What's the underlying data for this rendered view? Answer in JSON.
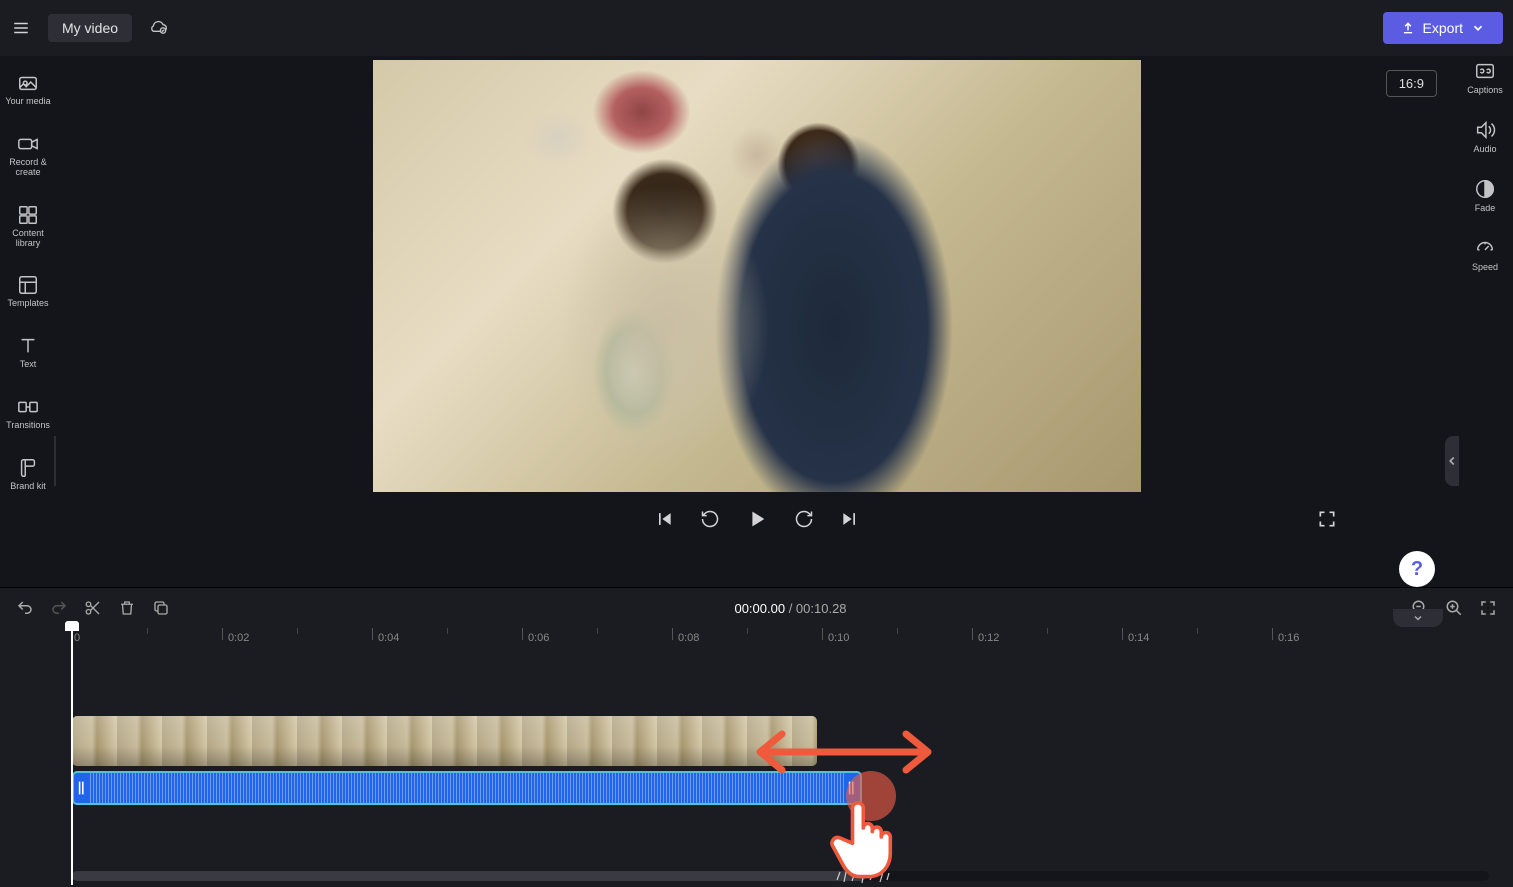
{
  "topbar": {
    "title": "My video",
    "export_label": "Export"
  },
  "aspect_ratio": "16:9",
  "left_sidebar": {
    "items": [
      {
        "label": "Your media"
      },
      {
        "label": "Record & create"
      },
      {
        "label": "Content library"
      },
      {
        "label": "Templates"
      },
      {
        "label": "Text"
      },
      {
        "label": "Transitions"
      },
      {
        "label": "Brand kit"
      }
    ]
  },
  "right_sidebar": {
    "items": [
      {
        "label": "Captions"
      },
      {
        "label": "Audio"
      },
      {
        "label": "Fade"
      },
      {
        "label": "Speed"
      }
    ]
  },
  "help_label": "?",
  "timecode": {
    "current": "00:00.00",
    "separator": " / ",
    "total": "00:10.28"
  },
  "ruler": {
    "start": "0",
    "marks": [
      "0:02",
      "0:04",
      "0:06",
      "0:08",
      "0:10",
      "0:12",
      "0:14",
      "0:16"
    ]
  }
}
